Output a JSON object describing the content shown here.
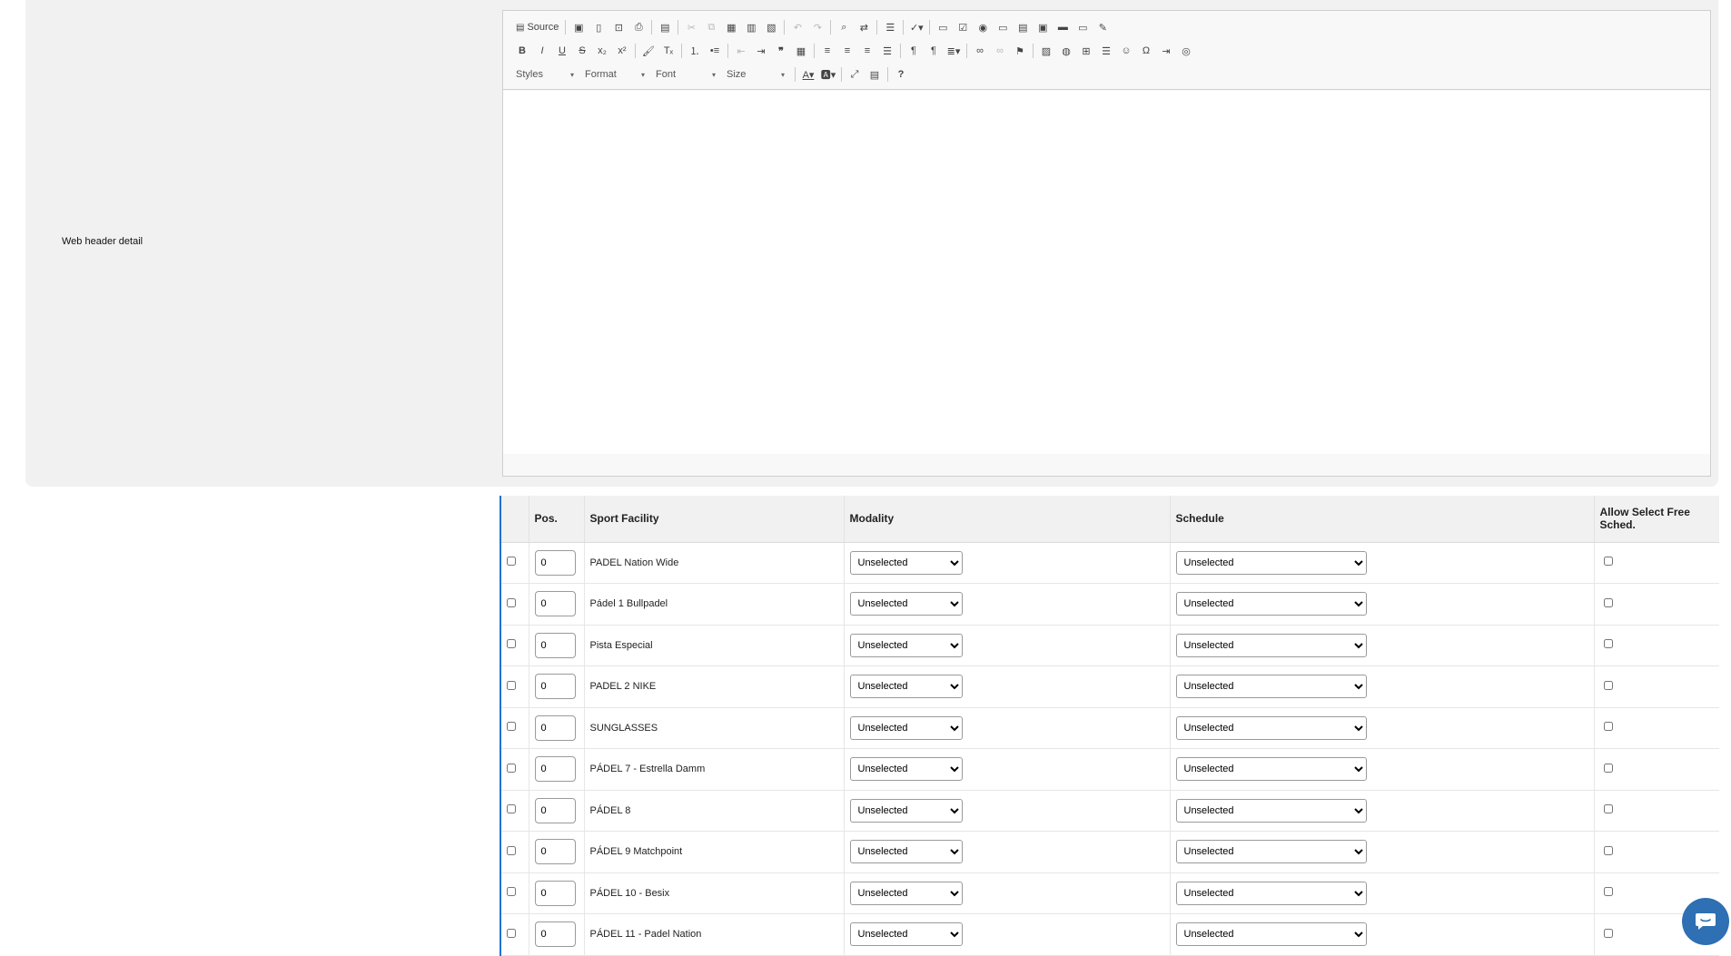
{
  "form": {
    "label": "Web header detail"
  },
  "editor": {
    "source_label": "Source",
    "combos": {
      "styles": "Styles",
      "format": "Format",
      "font": "Font",
      "size": "Size"
    },
    "help_label": "?"
  },
  "grid": {
    "headers": {
      "pos": "Pos.",
      "facility": "Sport Facility",
      "modality": "Modality",
      "schedule": "Schedule",
      "allow": "Allow Select Free Sched."
    },
    "rows": [
      {
        "pos": "0",
        "facility": "PADEL Nation Wide",
        "modality": "Unselected",
        "schedule": "Unselected"
      },
      {
        "pos": "0",
        "facility": "Pádel 1 Bullpadel",
        "modality": "Unselected",
        "schedule": "Unselected"
      },
      {
        "pos": "0",
        "facility": "Pista Especial",
        "modality": "Unselected",
        "schedule": "Unselected"
      },
      {
        "pos": "0",
        "facility": "PADEL 2 NIKE",
        "modality": "Unselected",
        "schedule": "Unselected"
      },
      {
        "pos": "0",
        "facility": "SUNGLASSES",
        "modality": "Unselected",
        "schedule": "Unselected"
      },
      {
        "pos": "0",
        "facility": "PÁDEL 7 - Estrella Damm",
        "modality": "Unselected",
        "schedule": "Unselected"
      },
      {
        "pos": "0",
        "facility": "PÁDEL 8",
        "modality": "Unselected",
        "schedule": "Unselected"
      },
      {
        "pos": "0",
        "facility": "PÁDEL 9 Matchpoint",
        "modality": "Unselected",
        "schedule": "Unselected"
      },
      {
        "pos": "0",
        "facility": "PÁDEL 10 - Besix",
        "modality": "Unselected",
        "schedule": "Unselected"
      },
      {
        "pos": "0",
        "facility": "PÁDEL 11 - Padel Nation",
        "modality": "Unselected",
        "schedule": "Unselected"
      }
    ]
  },
  "colors": {
    "accent": "#1f74d0",
    "chat": "#2f6fb3",
    "panel": "#f1f1f1"
  }
}
